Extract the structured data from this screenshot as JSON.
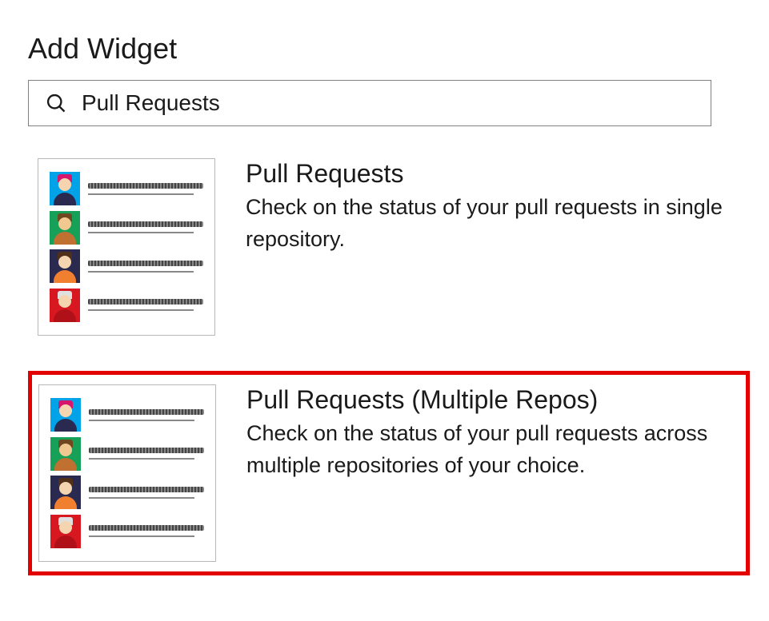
{
  "header": {
    "title": "Add Widget"
  },
  "search": {
    "value": "Pull Requests"
  },
  "widgets": [
    {
      "title": "Pull Requests",
      "description": "Check on the status of your pull requests in single repository.",
      "highlighted": false
    },
    {
      "title": "Pull Requests (Multiple Repos)",
      "description": "Check on the status of your pull requests across multiple repositories of your choice.",
      "highlighted": true
    }
  ],
  "thumb_avatars": [
    {
      "bg": "#00a2e8",
      "head": "#f5d5b0",
      "body": "#2a2a50",
      "hat": "#d6156c"
    },
    {
      "bg": "#16a058",
      "head": "#f0c890",
      "body": "#c07030",
      "hat": "#704820"
    },
    {
      "bg": "#2a2a50",
      "head": "#f5d5b0",
      "body": "#f08030",
      "hat": "#503018"
    },
    {
      "bg": "#d81820",
      "head": "#f5d5b0",
      "body": "#b01018",
      "hat": "#e0e0e0"
    }
  ]
}
